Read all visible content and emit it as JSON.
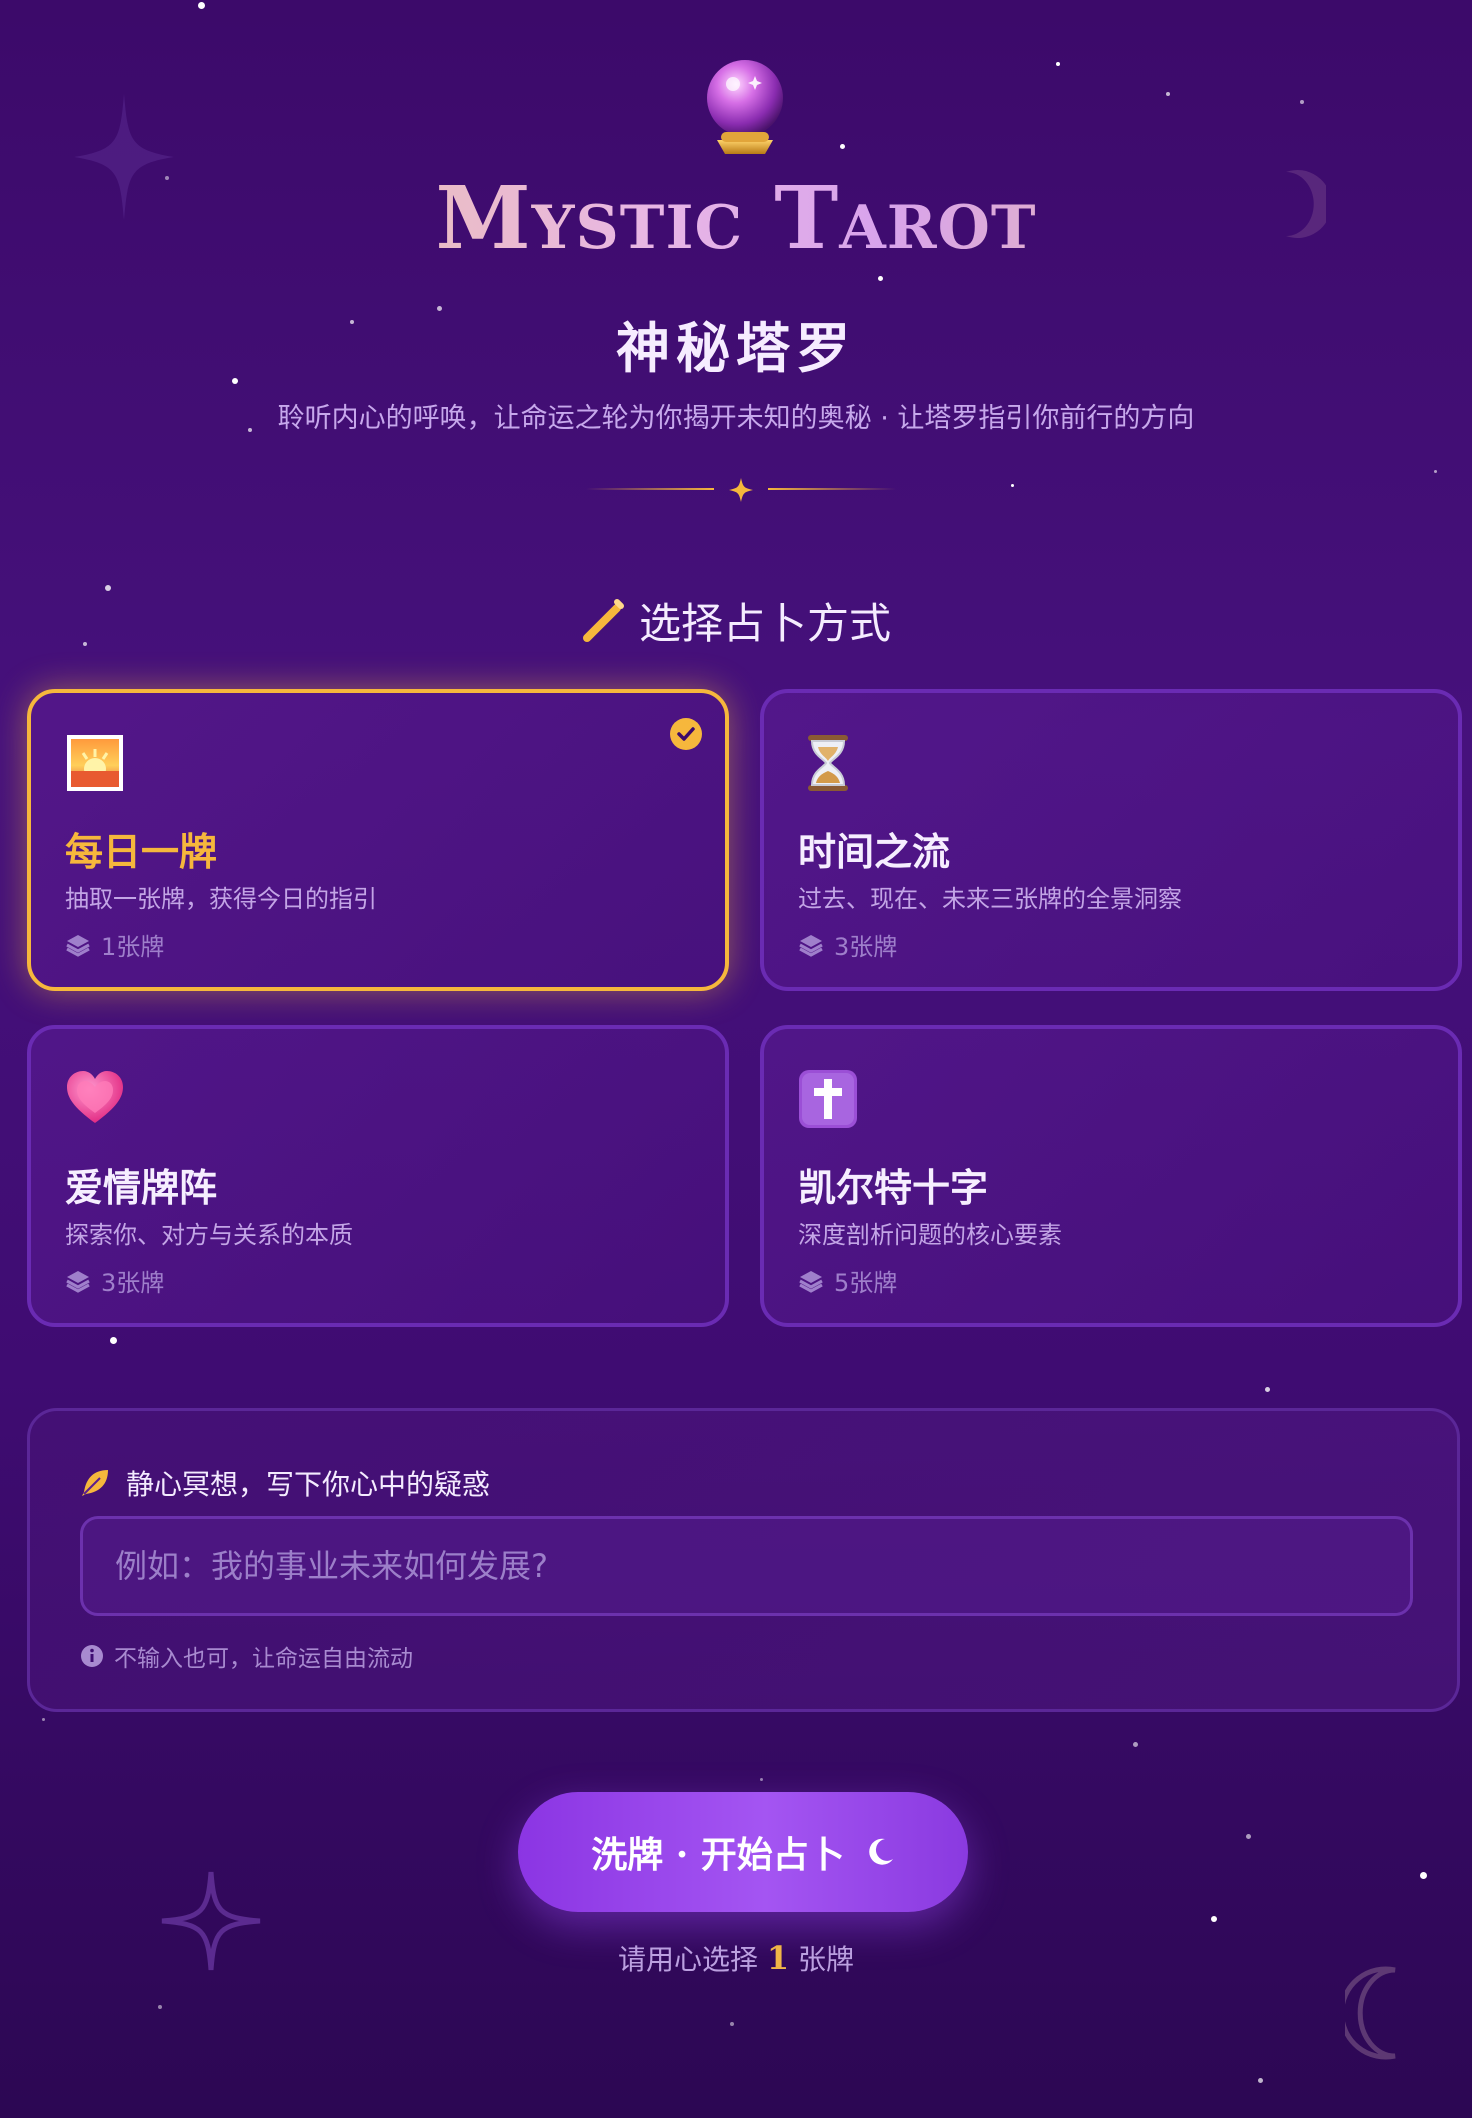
{
  "header": {
    "title": "Mystic Tarot",
    "subtitle": "神秘塔罗",
    "tagline": "聆听内心的呼唤，让命运之轮为你揭开未知的奥秘 · 让塔罗指引你前行的方向"
  },
  "section": {
    "title": "选择占卜方式"
  },
  "spreads": [
    {
      "icon": "sunrise-icon",
      "title": "每日一牌",
      "desc": "抽取一张牌，获得今日的指引",
      "count": "1张牌",
      "selected": true
    },
    {
      "icon": "hourglass-icon",
      "title": "时间之流",
      "desc": "过去、现在、未来三张牌的全景洞察",
      "count": "3张牌",
      "selected": false
    },
    {
      "icon": "heart-icon",
      "title": "爱情牌阵",
      "desc": "探索你、对方与关系的本质",
      "count": "3张牌",
      "selected": false
    },
    {
      "icon": "cross-icon",
      "title": "凯尔特十字",
      "desc": "深度剖析问题的核心要素",
      "count": "5张牌",
      "selected": false
    }
  ],
  "question": {
    "label": "静心冥想，写下你心中的疑惑",
    "placeholder": "例如：我的事业未来如何发展?",
    "value": "",
    "hint": "不输入也可，让命运自由流动"
  },
  "action": {
    "button_label": "洗牌 · 开始占卜",
    "hint_prefix": "请用心选择",
    "hint_count": "1",
    "hint_suffix": "张牌"
  },
  "colors": {
    "accent_gold": "#f6b73c",
    "card_border": "#6a2bb3",
    "button_purple": "#9b4bf0"
  }
}
